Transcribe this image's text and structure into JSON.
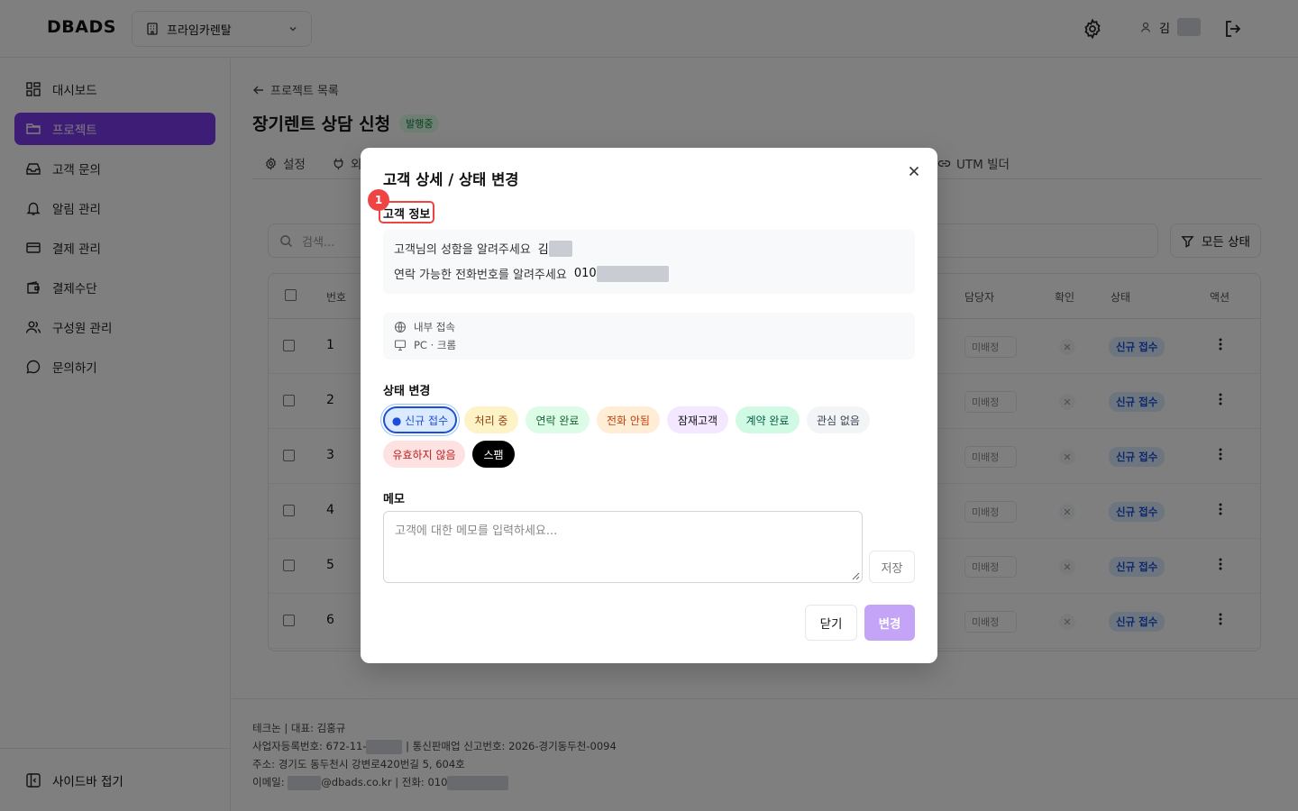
{
  "header": {
    "logo": "DBADS",
    "workspace": "프라임카렌탈",
    "user_initial": "김"
  },
  "sidebar": {
    "items": [
      {
        "label": "대시보드",
        "icon": "dashboard-icon"
      },
      {
        "label": "프로젝트",
        "icon": "folder-icon"
      },
      {
        "label": "고객 문의",
        "icon": "inbox-icon"
      },
      {
        "label": "알림 관리",
        "icon": "bell-icon"
      },
      {
        "label": "결제 관리",
        "icon": "card-icon"
      },
      {
        "label": "결제수단",
        "icon": "wallet-icon"
      },
      {
        "label": "구성원 관리",
        "icon": "users-icon"
      },
      {
        "label": "문의하기",
        "icon": "chat-icon"
      }
    ],
    "collapse_label": "사이드바 접기"
  },
  "main": {
    "back_label": "프로젝트 목록",
    "project_title": "장기렌트 상담 신청",
    "project_badge": "발행중",
    "tabs": [
      {
        "label": "설정"
      },
      {
        "label": "외"
      },
      {
        "label": "UTM 빌더"
      }
    ],
    "search_placeholder": "검색...",
    "filter_label": "모든 상태",
    "table": {
      "headers": {
        "no": "번호",
        "assignee": "담당자",
        "check": "확인",
        "status": "상태",
        "action": "액션"
      },
      "rows": [
        {
          "no": "1",
          "assignee": "미배정",
          "status": "신규 접수"
        },
        {
          "no": "2",
          "assignee": "미배정",
          "status": "신규 접수"
        },
        {
          "no": "3",
          "assignee": "미배정",
          "status": "신규 접수"
        },
        {
          "no": "4",
          "assignee": "미배정",
          "status": "신규 접수"
        },
        {
          "no": "5",
          "assignee": "미배정",
          "status": "신규 접수"
        },
        {
          "no": "6",
          "assignee": "미배정",
          "status": "신규 접수"
        }
      ]
    },
    "footer": {
      "line1": "테크논 | 대표: 김홍규",
      "line2_pre": "사업자등록번호: 672-11-",
      "line2_post": " | 통신판매업 신고번호: 2026-경기동두천-0094",
      "line3": "주소: 경기도 동두천시 강변로420번길 5, 604호",
      "line4_pre": "이메일: ",
      "line4_mid": "@dbads.co.kr | 전화: 010"
    }
  },
  "modal": {
    "title": "고객 상세 / 상태 변경",
    "step_marker": "1",
    "info_section_label": "고객 정보",
    "fields": [
      {
        "label": "고객님의 성함을 알려주세요",
        "value": "김"
      },
      {
        "label": "연락 가능한 전화번호를 알려주세요",
        "value": "010"
      }
    ],
    "meta": {
      "source": "내부 접속",
      "device": "PC · 크롬"
    },
    "status_section_label": "상태 변경",
    "statuses": [
      {
        "label": "● 신규 접수",
        "bg": "#dbeafe",
        "fg": "#1d4ed8",
        "selected": true
      },
      {
        "label": "처리 중",
        "bg": "#fef3c7",
        "fg": "#92400e"
      },
      {
        "label": "연락 완료",
        "bg": "#dcfce7",
        "fg": "#166534"
      },
      {
        "label": "전화 안됨",
        "bg": "#ffedd5",
        "fg": "#c2410c"
      },
      {
        "label": "잠재고객",
        "bg": "#f3e8ff",
        "fg": "#111111"
      },
      {
        "label": "계약 완료",
        "bg": "#d1fae5",
        "fg": "#065f46"
      },
      {
        "label": "관심 없음",
        "bg": "#f3f4f6",
        "fg": "#374151"
      },
      {
        "label": "유효하지 않음",
        "bg": "#fee2e2",
        "fg": "#b91c1c"
      },
      {
        "label": "스팸",
        "bg": "#000000",
        "fg": "#ffffff"
      }
    ],
    "memo_section_label": "메모",
    "memo_placeholder": "고객에 대한 메모를 입력하세요...",
    "save_label": "저장",
    "close_label": "닫기",
    "change_label": "변경",
    "accent": "#7c3aed"
  }
}
